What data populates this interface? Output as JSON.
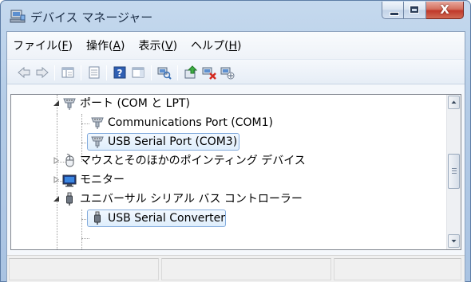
{
  "window": {
    "title": "デバイス マネージャー",
    "controls": {
      "minimize": "minimize",
      "maximize": "maximize",
      "close": "X"
    }
  },
  "menu": [
    {
      "text": "ファイル(",
      "key": "F",
      "after": ")"
    },
    {
      "text": "操作(",
      "key": "A",
      "after": ")"
    },
    {
      "text": "表示(",
      "key": "V",
      "after": ")"
    },
    {
      "text": "ヘルプ(",
      "key": "H",
      "after": ")"
    }
  ],
  "toolbar": {
    "icons": [
      "back-arrow-icon",
      "forward-arrow-icon",
      "show-hide-console-tree-icon",
      "properties-icon",
      "help-icon",
      "show-action-pane-icon",
      "scan-hardware-icon",
      "update-driver-icon",
      "uninstall-device-icon",
      "disable-device-icon"
    ]
  },
  "tree": {
    "rows": [
      {
        "label": "ポート (COM と LPT)",
        "expanded": true,
        "icon": "port-icon"
      },
      {
        "label": "Communications Port (COM1)",
        "icon": "port-icon"
      },
      {
        "label": "USB Serial Port (COM3)",
        "icon": "port-icon",
        "highlighted": true
      },
      {
        "label": "マウスとそのほかのポインティング デバイス",
        "expanded": false,
        "icon": "mouse-icon"
      },
      {
        "label": "モニター",
        "expanded": false,
        "icon": "monitor-icon"
      },
      {
        "label": "ユニバーサル シリアル バス コントローラー",
        "expanded": true,
        "icon": "usb-icon"
      },
      {
        "label": "USB Serial Converter",
        "icon": "usb-icon",
        "highlighted": true
      }
    ]
  },
  "colors": {
    "title_bar": "#b3cbe6",
    "selection_border": "#84acdd",
    "selection_fill": "#dfeefc",
    "close_button": "#c0392b"
  }
}
